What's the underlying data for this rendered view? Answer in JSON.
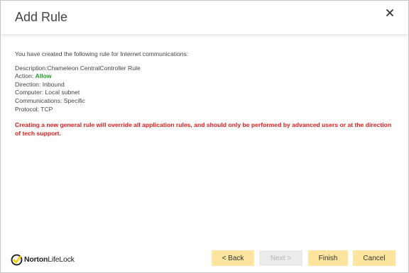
{
  "dialog": {
    "title": "Add Rule",
    "close_icon": "close-icon"
  },
  "content": {
    "intro": "You have created the following rule for Internet communications:",
    "rule": {
      "description_label": "Description:",
      "description_value": "Chameleon CentralController Rule",
      "action_label": "Action: ",
      "action_value": "Allow",
      "direction_label": "Direction: ",
      "direction_value": "Inbound",
      "computer_label": "Computer: ",
      "computer_value": "Local subnet",
      "communications_label": "Communications: ",
      "communications_value": "Specific",
      "protocol_label": "Protocol: ",
      "protocol_value": "TCP"
    },
    "warning": "Creating a new general rule will override all application rules, and should only be performed by advanced users or at the direction of tech support."
  },
  "footer": {
    "logo_text_bold": "Norton",
    "logo_text_light": "LifeLock",
    "buttons": {
      "back": "< Back",
      "next": "Next >",
      "finish": "Finish",
      "cancel": "Cancel"
    }
  },
  "colors": {
    "accent_button": "#fde5a0",
    "allow_green": "#1f9e24",
    "warning_red": "#e11b1b",
    "disabled_button": "#ececec",
    "norton_yellow": "#fecb00"
  }
}
